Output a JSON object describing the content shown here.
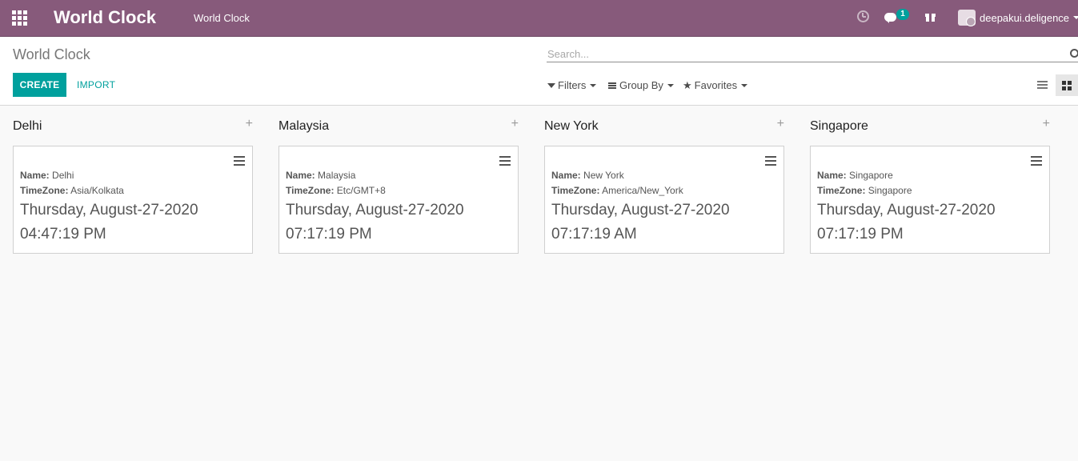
{
  "navbar": {
    "brand": "World Clock",
    "menu_item": "World Clock",
    "chat_badge": "1",
    "username": "deepakui.deligence",
    "color": "#875a7b"
  },
  "control_panel": {
    "breadcrumb": "World Clock",
    "search_placeholder": "Search...",
    "create_label": "CREATE",
    "import_label": "IMPORT",
    "filters_label": "Filters",
    "groupby_label": "Group By",
    "favorites_label": "Favorites",
    "accent": "#00a09d"
  },
  "columns": [
    {
      "title": "Delhi",
      "card": {
        "name_label": "Name:",
        "name": "Delhi",
        "tz_label": "TimeZone:",
        "tz": "Asia/Kolkata",
        "date": "Thursday, August-27-2020",
        "time": "04:47:19 PM"
      }
    },
    {
      "title": "Malaysia",
      "card": {
        "name_label": "Name:",
        "name": "Malaysia",
        "tz_label": "TimeZone:",
        "tz": "Etc/GMT+8",
        "date": "Thursday, August-27-2020",
        "time": "07:17:19 PM"
      }
    },
    {
      "title": "New York",
      "card": {
        "name_label": "Name:",
        "name": "New York",
        "tz_label": "TimeZone:",
        "tz": "America/New_York",
        "date": "Thursday, August-27-2020",
        "time": "07:17:19 AM"
      }
    },
    {
      "title": "Singapore",
      "card": {
        "name_label": "Name:",
        "name": "Singapore",
        "tz_label": "TimeZone:",
        "tz": "Singapore",
        "date": "Thursday, August-27-2020",
        "time": "07:17:19 PM"
      }
    }
  ]
}
